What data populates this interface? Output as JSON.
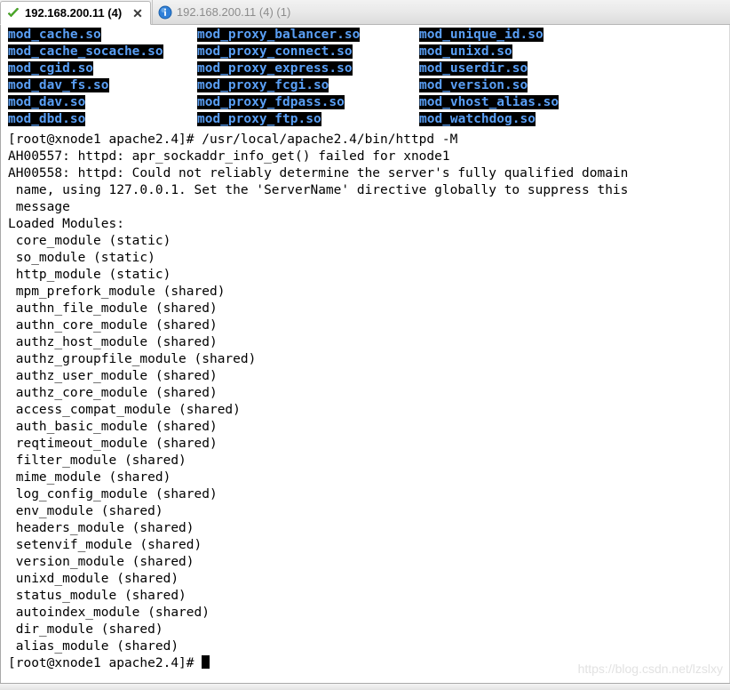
{
  "tabs": [
    {
      "label": "192.168.200.11 (4)",
      "icon": "check-icon",
      "active": true,
      "close_label": "✕"
    },
    {
      "label": "192.168.200.11 (4) (1)",
      "icon": "info-icon",
      "active": false
    }
  ],
  "terminal": {
    "module_columns": [
      [
        "mod_cache.so",
        "mod_cache_socache.so",
        "mod_cgid.so",
        "mod_dav_fs.so",
        "mod_dav.so",
        "mod_dbd.so"
      ],
      [
        "mod_proxy_balancer.so",
        "mod_proxy_connect.so",
        "mod_proxy_express.so",
        "mod_proxy_fcgi.so",
        "mod_proxy_fdpass.so",
        "mod_proxy_ftp.so"
      ],
      [
        "mod_unique_id.so",
        "mod_unixd.so",
        "mod_userdir.so",
        "mod_version.so",
        "mod_vhost_alias.so",
        "mod_watchdog.so"
      ]
    ],
    "lines": [
      "[root@xnode1 apache2.4]# /usr/local/apache2.4/bin/httpd -M",
      "AH00557: httpd: apr_sockaddr_info_get() failed for xnode1",
      "AH00558: httpd: Could not reliably determine the server's fully qualified domain",
      " name, using 127.0.0.1. Set the 'ServerName' directive globally to suppress this",
      " message",
      "Loaded Modules:",
      " core_module (static)",
      " so_module (static)",
      " http_module (static)",
      " mpm_prefork_module (shared)",
      " authn_file_module (shared)",
      " authn_core_module (shared)",
      " authz_host_module (shared)",
      " authz_groupfile_module (shared)",
      " authz_user_module (shared)",
      " authz_core_module (shared)",
      " access_compat_module (shared)",
      " auth_basic_module (shared)",
      " reqtimeout_module (shared)",
      " filter_module (shared)",
      " mime_module (shared)",
      " log_config_module (shared)",
      " env_module (shared)",
      " headers_module (shared)",
      " setenvif_module (shared)",
      " version_module (shared)",
      " unixd_module (shared)",
      " status_module (shared)",
      " autoindex_module (shared)",
      " dir_module (shared)",
      " alias_module (shared)"
    ],
    "prompt": "[root@xnode1 apache2.4]# ",
    "colors": {
      "module_background": "#000000",
      "module_text": "#5a9ff5",
      "terminal_background": "#ffffff",
      "terminal_text": "#000000"
    }
  },
  "watermark": "https://blog.csdn.net/lzslxy"
}
